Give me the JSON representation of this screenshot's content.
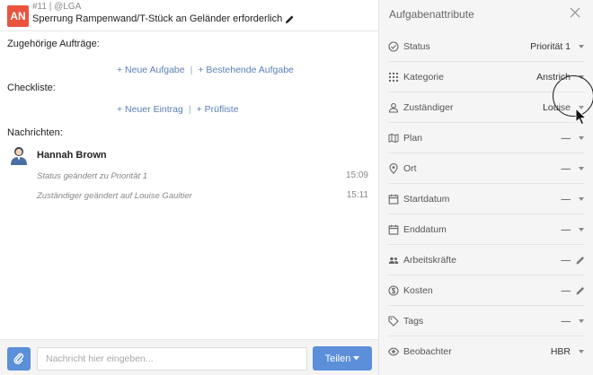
{
  "task": {
    "badge": "AN",
    "meta": "#11 | @LGA",
    "title": "Sperrung Rampenwand/T-Stück an Geländer erforderlich"
  },
  "sections": {
    "orders_title": "Zugehörige Aufträge:",
    "new_task": "+ Neue Aufgabe",
    "existing_task": "+ Bestehende Aufgabe",
    "checklist_title": "Checkliste:",
    "new_entry": "+ Neuer Eintrag",
    "check_list": "+ Prüfliste",
    "messages_title": "Nachrichten:",
    "separator": "|"
  },
  "messages": {
    "author": "Hannah Brown",
    "items": [
      {
        "text": "Status geändert zu Priorität 1",
        "time": "15:09"
      },
      {
        "text": "Zuständiger geändert auf Louise Gaultier",
        "time": "15:11"
      }
    ]
  },
  "composer": {
    "placeholder": "Nachricht hier eingeben...",
    "share_label": "Teilen"
  },
  "attributes_panel": {
    "title": "Aufgabenattribute",
    "items": [
      {
        "icon": "check-circle-icon",
        "label": "Status",
        "value": "Priorität 1",
        "control": "dropdown"
      },
      {
        "icon": "grid-icon",
        "label": "Kategorie",
        "value": "Anstrich",
        "control": "dropdown"
      },
      {
        "icon": "person-icon",
        "label": "Zuständiger",
        "value": "Louise",
        "control": "dropdown"
      },
      {
        "icon": "map-icon",
        "label": "Plan",
        "value": "—",
        "control": "dropdown"
      },
      {
        "icon": "location-pin-icon",
        "label": "Ort",
        "value": "—",
        "control": "dropdown"
      },
      {
        "icon": "calendar-icon",
        "label": "Startdatum",
        "value": "—",
        "control": "dropdown"
      },
      {
        "icon": "calendar-icon",
        "label": "Enddatum",
        "value": "—",
        "control": "dropdown"
      },
      {
        "icon": "people-icon",
        "label": "Arbeitskräfte",
        "value": "—",
        "control": "edit"
      },
      {
        "icon": "dollar-circle-icon",
        "label": "Kosten",
        "value": "—",
        "control": "edit"
      },
      {
        "icon": "tag-icon",
        "label": "Tags",
        "value": "—",
        "control": "dropdown"
      },
      {
        "icon": "eye-icon",
        "label": "Beobachter",
        "value": "HBR",
        "control": "dropdown"
      }
    ]
  },
  "colors": {
    "accent": "#5b8fd9",
    "badge": "#e8543e",
    "link": "#5b7fb7"
  }
}
